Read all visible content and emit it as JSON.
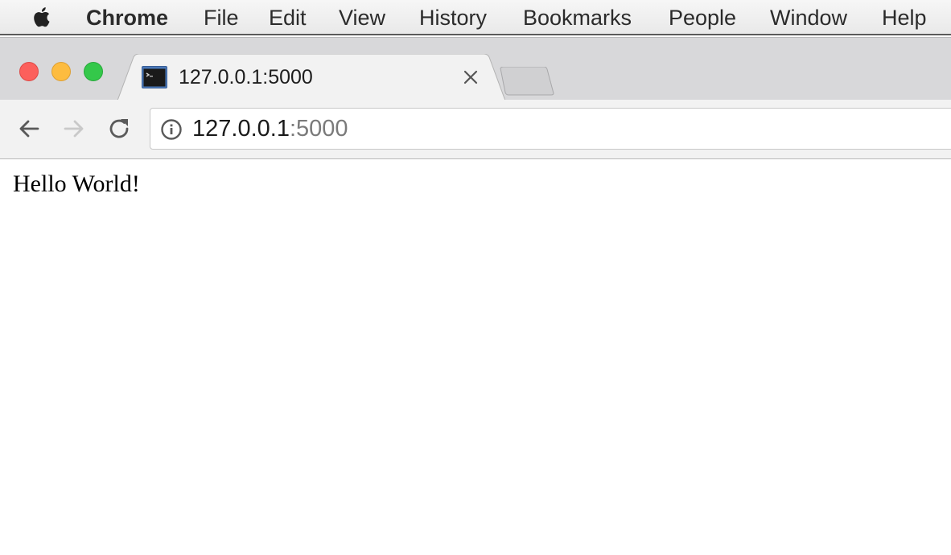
{
  "menubar": {
    "app_name": "Chrome",
    "items": [
      "File",
      "Edit",
      "View",
      "History",
      "Bookmarks",
      "People",
      "Window",
      "Help"
    ]
  },
  "tab": {
    "title": "127.0.0.1:5000",
    "favicon": "terminal-icon"
  },
  "omnibox": {
    "host": "127.0.0.1",
    "port": ":5000"
  },
  "page": {
    "text": "Hello World!"
  },
  "colors": {
    "close_light": "#fc605c",
    "minimize_light": "#fdbc40",
    "zoom_light": "#34c84a"
  }
}
